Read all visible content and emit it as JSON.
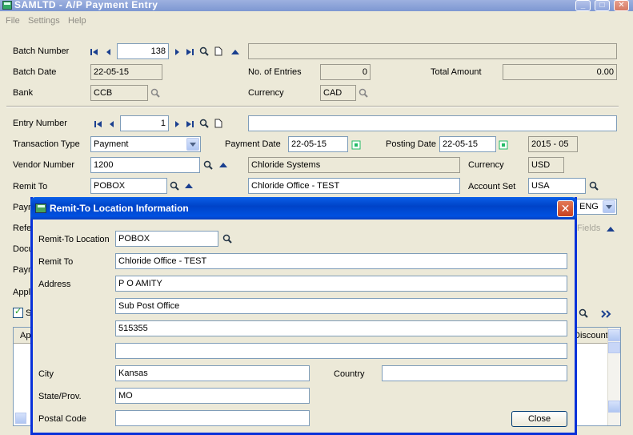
{
  "window": {
    "title": "SAMLTD - A/P Payment Entry"
  },
  "menu": [
    "File",
    "Settings",
    "Help"
  ],
  "batch": {
    "number_label": "Batch Number",
    "number": "138",
    "date_label": "Batch Date",
    "date": "22-05-15",
    "entries_label": "No. of Entries",
    "entries": "0",
    "total_label": "Total Amount",
    "total": "0.00",
    "bank_label": "Bank",
    "bank": "CCB",
    "currency_label": "Currency",
    "currency": "CAD"
  },
  "entry": {
    "number_label": "Entry Number",
    "number": "1",
    "transaction_type_label": "Transaction Type",
    "transaction_type": "Payment",
    "payment_date_label": "Payment Date",
    "payment_date": "22-05-15",
    "posting_date_label": "Posting Date",
    "posting_date": "22-05-15",
    "period": "2015 - 05",
    "vendor_label": "Vendor Number",
    "vendor": "1200",
    "vendor_name": "Chloride Systems",
    "currency_label": "Currency",
    "currency": "USD",
    "remit_label": "Remit To",
    "remit": "POBOX",
    "remit_name": "Chloride Office - TEST",
    "account_set_label": "Account Set",
    "account_set": "USA",
    "partial_labels": {
      "pay": "Paym",
      "ref": "Refe",
      "doc": "Docu",
      "pay2": "Paym",
      "appl": "Appl",
      "s": "S",
      "ap": "Ap"
    },
    "lang": "ENG",
    "fields_partial": "Fields",
    "discount_partial": "Discount"
  },
  "dialog": {
    "title": "Remit-To Location Information",
    "location_label": "Remit-To Location",
    "location": "POBOX",
    "remit_label": "Remit To",
    "remit": "Chloride Office - TEST",
    "address_label": "Address",
    "address": [
      "P O AMITY",
      "Sub Post Office",
      "515355",
      ""
    ],
    "city_label": "City",
    "city": "Kansas",
    "country_label": "Country",
    "country": "",
    "state_label": "State/Prov.",
    "state": "MO",
    "postal_label": "Postal Code",
    "postal": "",
    "close_label": "Close"
  },
  "icons": [
    "first-icon",
    "previous-icon",
    "next-icon",
    "last-icon",
    "finder-icon",
    "new-icon",
    "zoom-up-icon",
    "calendar-icon",
    "close-icon",
    "double-chevron-icon"
  ]
}
